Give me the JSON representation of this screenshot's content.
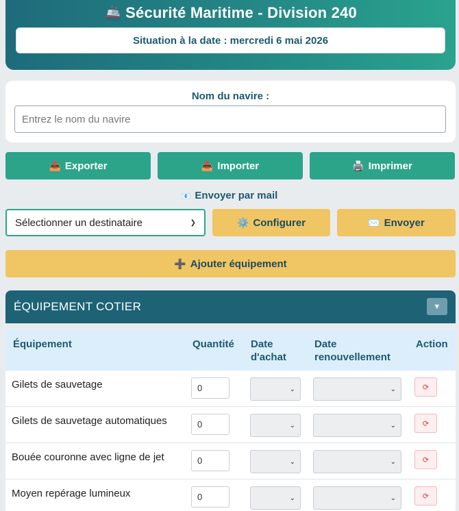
{
  "header": {
    "ship_icon": "🚢",
    "title": "Sécurité Maritime - Division 240",
    "date_text": "Situation à la date : mercredi 6 mai 2026"
  },
  "ship": {
    "label": "Nom du navire :",
    "placeholder": "Entrez le nom du navire"
  },
  "actions": {
    "export": {
      "icon": "📤",
      "label": "Exporter"
    },
    "import": {
      "icon": "📥",
      "label": "Importer"
    },
    "print": {
      "icon": "🖨️",
      "label": "Imprimer"
    }
  },
  "mail": {
    "icon": "📧",
    "label": "Envoyer par mail",
    "recipient_select": "Sélectionner un destinataire",
    "configure": {
      "icon": "⚙️",
      "label": "Configurer"
    },
    "send": {
      "icon": "✉️",
      "label": "Envoyer"
    }
  },
  "add_equipment": {
    "icon": "➕",
    "label": "Ajouter équipement"
  },
  "section": {
    "title": "ÉQUIPEMENT COTIER",
    "toggle_icon": "▼"
  },
  "table": {
    "headers": {
      "equipment": "Équipement",
      "quantity": "Quantité",
      "purchase_date": "Date d'achat",
      "renewal_date": "Date renouvellement",
      "action": "Action"
    },
    "rows": [
      {
        "name": "Gilets de sauvetage",
        "quantity": "0"
      },
      {
        "name": "Gilets de sauvetage automatiques",
        "quantity": "0"
      },
      {
        "name": "Bouée couronne avec ligne de jet",
        "quantity": "0"
      },
      {
        "name": "Moyen repérage lumineux",
        "quantity": "0"
      }
    ],
    "reset_icon": "⟳"
  },
  "colors": {
    "teal": "#2ba48a",
    "yellow": "#f0c564",
    "navy": "#1e6276",
    "header_bg": "#dceefb"
  }
}
